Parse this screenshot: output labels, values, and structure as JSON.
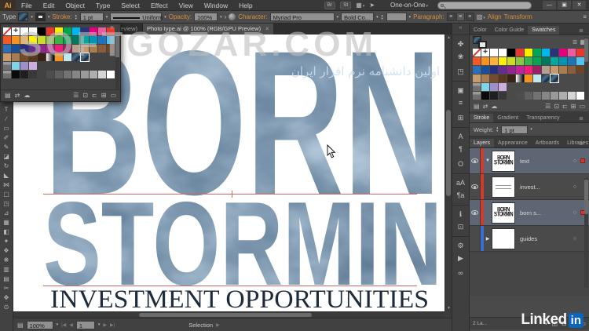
{
  "menubar": {
    "logo": "Ai",
    "items": [
      "File",
      "Edit",
      "Object",
      "Type",
      "Select",
      "Effect",
      "View",
      "Window",
      "Help"
    ],
    "br_button": "Br",
    "st_button": "St",
    "workspace_icon": "▦",
    "share_icon": "➤",
    "workspace": "One-on-One",
    "search_placeholder": ""
  },
  "window_controls": {
    "minimize": "—",
    "restore": "▣",
    "close": "✕"
  },
  "controlbar": {
    "context_label": "Type",
    "stroke_label": "Stroke:",
    "stroke_weight": "1 pt",
    "variable_width": "Uniform",
    "opacity_label": "Opacity:",
    "opacity_value": "100%",
    "more_arrow": "›",
    "character_label": "Character:",
    "font_name": "Myriad Pro",
    "font_style": "Bold Co...",
    "paragraph_label": "Paragraph:",
    "align_glyph": "≡",
    "text_options_glyph": "▧",
    "align_label": "Align",
    "transform_label": "Transform",
    "panel_menu_glyph": "≡"
  },
  "tabs": {
    "background_partial": "PU Preview)",
    "active": "Photo type.ai @ 100% (RGB/GPU Preview)",
    "close": "×"
  },
  "artwork": {
    "line1": "BORN",
    "line2": "STORMIN",
    "line3": "INVESTMENT OPPORTUNITIES",
    "guide_color": "#c96b63",
    "serif_color": "#1d2b3a"
  },
  "toolbar": {
    "tools": [
      {
        "name": "type-tool",
        "glyph": "T"
      },
      {
        "name": "line-segment-tool",
        "glyph": "∕"
      },
      {
        "name": "rectangle-tool",
        "glyph": "▭"
      },
      {
        "name": "paintbrush-tool",
        "glyph": "✐"
      },
      {
        "name": "pencil-tool",
        "glyph": "✎"
      },
      {
        "name": "eraser-tool",
        "glyph": "◪"
      },
      {
        "name": "rotate-tool",
        "glyph": "↻"
      },
      {
        "name": "scale-tool",
        "glyph": "◣"
      },
      {
        "name": "width-tool",
        "glyph": "⋈"
      },
      {
        "name": "free-transform-tool",
        "glyph": "▢"
      },
      {
        "name": "shape-builder-tool",
        "glyph": "◳"
      },
      {
        "name": "perspective-grid-tool",
        "glyph": "⊿"
      },
      {
        "name": "mesh-tool",
        "glyph": "▦"
      },
      {
        "name": "gradient-tool",
        "glyph": "◧"
      },
      {
        "name": "eyedropper-tool",
        "glyph": "✦"
      },
      {
        "name": "blend-tool",
        "glyph": "❖"
      },
      {
        "name": "symbol-sprayer-tool",
        "glyph": "❋"
      },
      {
        "name": "column-graph-tool",
        "glyph": "▥"
      },
      {
        "name": "artboard-tool",
        "glyph": "▤"
      },
      {
        "name": "slice-tool",
        "glyph": "✂"
      },
      {
        "name": "hand-tool",
        "glyph": "✥"
      },
      {
        "name": "zoom-tool",
        "glyph": "⊙"
      }
    ]
  },
  "icon_dock": {
    "collapse": "«",
    "icons": [
      {
        "name": "brushes-panel-icon",
        "glyph": "✤",
        "g": true
      },
      {
        "name": "symbols-panel-icon",
        "glyph": "❀"
      },
      {
        "name": "graphic-styles-panel-icon",
        "glyph": "◳"
      },
      {
        "name": "transform-panel-icon",
        "glyph": "▣",
        "g": true
      },
      {
        "name": "align-panel-icon",
        "glyph": "≡"
      },
      {
        "name": "pathfinder-panel-icon",
        "glyph": "⊞"
      },
      {
        "name": "character-panel-icon",
        "glyph": "A",
        "g": true
      },
      {
        "name": "paragraph-panel-icon",
        "glyph": "¶"
      },
      {
        "name": "opentype-panel-icon",
        "glyph": "O"
      },
      {
        "name": "character-styles-panel-icon",
        "glyph": "aA",
        "g": true
      },
      {
        "name": "paragraph-styles-panel-icon",
        "glyph": "¶a"
      },
      {
        "name": "info-panel-icon",
        "glyph": "ℹ",
        "g": true
      },
      {
        "name": "document-info-panel-icon",
        "glyph": "⊡"
      },
      {
        "name": "variables-panel-icon",
        "glyph": "⚙",
        "g": true
      },
      {
        "name": "actions-panel-icon",
        "glyph": "▶"
      },
      {
        "name": "links-panel-icon",
        "glyph": "∞"
      }
    ]
  },
  "swatches_grid": [
    [
      "none",
      "reg",
      "#ffffff",
      "#ffffff",
      "#000000",
      "#e8382d",
      "#fdee00",
      "#00a651",
      "#00b6ed",
      "#29337a",
      "#e6007e",
      "#ef5ba1",
      "#e8382d"
    ],
    [
      "#f05a28",
      "#f7941e",
      "#fbb040",
      "#fff200",
      "#cbdb2a",
      "#8dc63f",
      "#37b34a",
      "#00a651",
      "#00785e",
      "#00a99d",
      "#0094b5",
      "#1b75bb",
      "#55c3f0"
    ],
    [
      "#2b6fb6",
      "#164f9a",
      "#262f80",
      "#652d90",
      "#92278f",
      "#c4219b",
      "#ed1e79",
      "#9e1f63",
      "#b5a08c",
      "#c7996c",
      "#aa7d4e",
      "#8a5d3b",
      "#6e4426"
    ],
    [
      "#c69c6d",
      "#a97c50",
      "#754c29",
      "#5a381d",
      "#3a2314",
      "grad",
      "#f7941e",
      "#bfe8f0",
      "img",
      "img_sel",
      "",
      "",
      ""
    ],
    [
      "folder",
      "#7fd4e8",
      "#9e8fc8",
      "#c9aede",
      "",
      "",
      "",
      "",
      "",
      "",
      "",
      "",
      ""
    ],
    [
      "folder",
      "#0a0a0a",
      "#1f1f1f",
      "#383838",
      "",
      "#4d4d4d",
      "#606060",
      "#737373",
      "#868686",
      "#9a9a9a",
      "#aeaeae",
      "#d5d5d5",
      "#ffffff"
    ]
  ],
  "swatch_bottom_icons": {
    "left": [
      {
        "name": "swatch-libraries-button",
        "glyph": "▤"
      },
      {
        "name": "share-swatches-button",
        "glyph": "⇄"
      },
      {
        "name": "sync-swatches-button",
        "glyph": "☁"
      }
    ],
    "right": [
      {
        "name": "swatch-kinds-button",
        "glyph": "☰"
      },
      {
        "name": "swatch-options-button",
        "glyph": "⊡"
      },
      {
        "name": "new-color-group-button",
        "glyph": "⊏"
      },
      {
        "name": "new-swatch-button",
        "glyph": "⊞"
      },
      {
        "name": "delete-swatch-button",
        "glyph": "▭"
      }
    ]
  },
  "panels": {
    "color_tabs": {
      "items": [
        "Color",
        "Color Guide",
        "Swatches"
      ],
      "active": "Swatches",
      "menu": "≣"
    },
    "swatches": {
      "view_list": "≣",
      "view_grid": "▦"
    },
    "stroke": {
      "tabs": [
        "Stroke",
        "Gradient",
        "Transparency"
      ],
      "active": "Stroke",
      "menu": "≣",
      "weight_label": "Weight:",
      "weight_value": "1 pt"
    },
    "layers": {
      "tabs": [
        "Layers",
        "Appearance",
        "Artboards",
        "Libraries"
      ],
      "active": "Layers",
      "menu": "≣",
      "rows": [
        {
          "label": "text",
          "eye": true,
          "bar": "#d23a2e",
          "expand": "▼",
          "thumb": "born",
          "selected": true,
          "target": "○",
          "badge": true
        },
        {
          "label": "invest...",
          "eye": true,
          "bar": "#d23a2e",
          "expand": "",
          "thumb": "lines",
          "selected": false,
          "target": "○",
          "badge": false
        },
        {
          "label": "born s...",
          "eye": true,
          "bar": "#d23a2e",
          "expand": "",
          "thumb": "born",
          "selected": true,
          "target": "○",
          "badge": true
        },
        {
          "label": "guides",
          "eye": false,
          "bar": "#3a6fd2",
          "expand": "▶",
          "thumb": "blank",
          "selected": false,
          "target": "○",
          "badge": false
        }
      ],
      "status": "2 La...",
      "bottom_icons": [
        {
          "name": "locate-object-button",
          "glyph": "⌖"
        },
        {
          "name": "clipping-mask-button",
          "glyph": "◫"
        },
        {
          "name": "new-sublayer-button",
          "glyph": "⊟"
        },
        {
          "name": "new-layer-button",
          "glyph": "⊞"
        },
        {
          "name": "delete-layer-button",
          "glyph": "▭"
        }
      ]
    }
  },
  "statusbar": {
    "doc_icon": "▤",
    "zoom": "100%",
    "nav_first": "|◀",
    "nav_prev": "◀",
    "artboard": "1",
    "nav_next": "▶",
    "nav_last": "▶|",
    "status": "Selection",
    "status_arrow": "▶"
  },
  "watermark": {
    "big": "SOFTGOZAR.COM",
    "persian": "اولین دانشنامه نرم افزار ایران",
    "linkedin_text": "Linked",
    "linkedin_badge": "in"
  }
}
